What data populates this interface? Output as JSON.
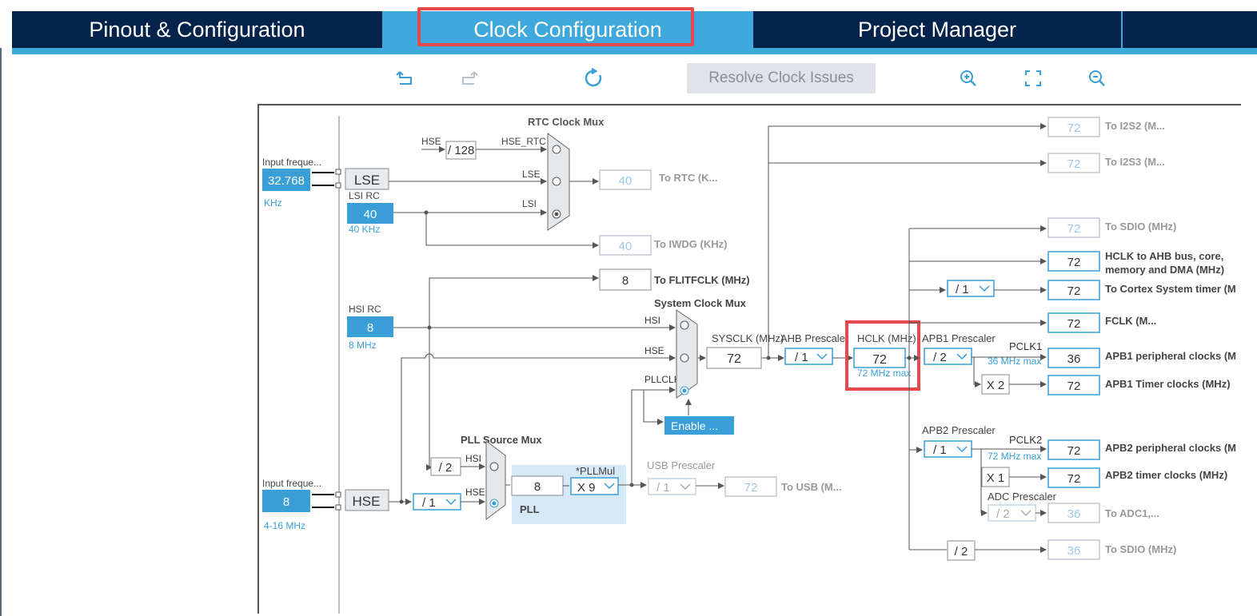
{
  "tabs": {
    "pinout": "Pinout & Configuration",
    "clock": "Clock Configuration",
    "project": "Project Manager"
  },
  "toolbar": {
    "resolve_label": "Resolve Clock Issues",
    "undo_icon": "undo-icon",
    "redo_icon": "redo-icon",
    "refresh_icon": "refresh-icon",
    "zoom_in_icon": "zoom-in-icon",
    "fit_icon": "fullscreen-icon",
    "zoom_out_icon": "zoom-out-icon"
  },
  "colors": {
    "navy": "#03234b",
    "accent": "#3fa9db",
    "highlight": "#e8474c",
    "input_blue": "#3a9fd6"
  },
  "diagram": {
    "lse_input_label": "Input freque...",
    "lse_input_value": "32.768",
    "lse_input_unit": "KHz",
    "lse_label": "LSE",
    "lsi_label": "LSI RC",
    "lsi_value": "40",
    "lsi_unit": "40 KHz",
    "hsi_label": "HSI RC",
    "hsi_value": "8",
    "hsi_unit": "8 MHz",
    "hse_input_label": "Input freque...",
    "hse_input_value": "8",
    "hse_input_unit": "4-16 MHz",
    "hse_label": "HSE",
    "rtc_mux_title": "RTC Clock Mux",
    "rtc_hse_label": "HSE",
    "rtc_div_value": "/ 128",
    "rtc_hse_rtc_label": "HSE_RTC",
    "rtc_lse_label": "LSE",
    "rtc_lsi_label": "LSI",
    "rtc_out_value": "40",
    "rtc_out_label": "To RTC (K...",
    "iwdg_out_value": "40",
    "iwdg_out_label": "To IWDG (KHz)",
    "flit_value": "8",
    "flit_label": "To FLITFCLK (MHz)",
    "sys_mux_title": "System Clock Mux",
    "sys_hsi_label": "HSI",
    "sys_hse_label": "HSE",
    "sys_pll_label": "PLLCLK",
    "enable_label": "Enable ...",
    "sysclk_label": "SYSCLK (MHz)",
    "sysclk_value": "72",
    "ahb_label": "AHB Prescaler",
    "ahb_value": "/ 1",
    "hclk_label": "HCLK (MHz)",
    "hclk_value": "72",
    "hclk_max": "72 MHz max",
    "pll_src_title": "PLL Source Mux",
    "pll_hsi_div": "/ 2",
    "pll_hsi_label": "HSI",
    "pll_hse_label": "HSE",
    "hse_prediv": "/ 1",
    "pll_value": "8",
    "pll_label": "PLL",
    "pllmul_label": "*PLLMul",
    "pllmul_value": "X 9",
    "usb_label": "USB Prescaler",
    "usb_div": "/ 1",
    "usb_value": "72",
    "usb_out_label": "To USB (M...",
    "apb1_label": "APB1 Prescaler",
    "apb1_value": "/ 2",
    "pclk1_label": "PCLK1",
    "pclk1_max": "36 MHz max",
    "apb1_x2": "X 2",
    "apb2_label": "APB2 Prescaler",
    "apb2_value": "/ 1",
    "pclk2_label": "PCLK2",
    "pclk2_max": "72 MHz max",
    "apb2_x1": "X 1",
    "adc_label": "ADC Prescaler",
    "adc_value": "/ 2",
    "sdio_div": "/ 2",
    "cortex_div": "/ 1",
    "outputs": [
      {
        "value": "72",
        "label": "To I2S2 (M..."
      },
      {
        "value": "72",
        "label": "To I2S3 (M..."
      },
      {
        "value": "72",
        "label": "To SDIO (MHz)"
      },
      {
        "value": "72",
        "label": "HCLK to AHB bus, core,",
        "label2": "memory and DMA (MHz)"
      },
      {
        "value": "72",
        "label": "To Cortex System timer (M"
      },
      {
        "value": "72",
        "label": "FCLK (M..."
      },
      {
        "value": "36",
        "label": "APB1 peripheral clocks (M"
      },
      {
        "value": "72",
        "label": "APB1 Timer clocks (MHz)"
      },
      {
        "value": "72",
        "label": "APB2 peripheral clocks (M"
      },
      {
        "value": "72",
        "label": "APB2 timer clocks (MHz)"
      },
      {
        "value": "36",
        "label": "To ADC1,..."
      },
      {
        "value": "36",
        "label": "To SDIO (MHz)"
      }
    ]
  }
}
